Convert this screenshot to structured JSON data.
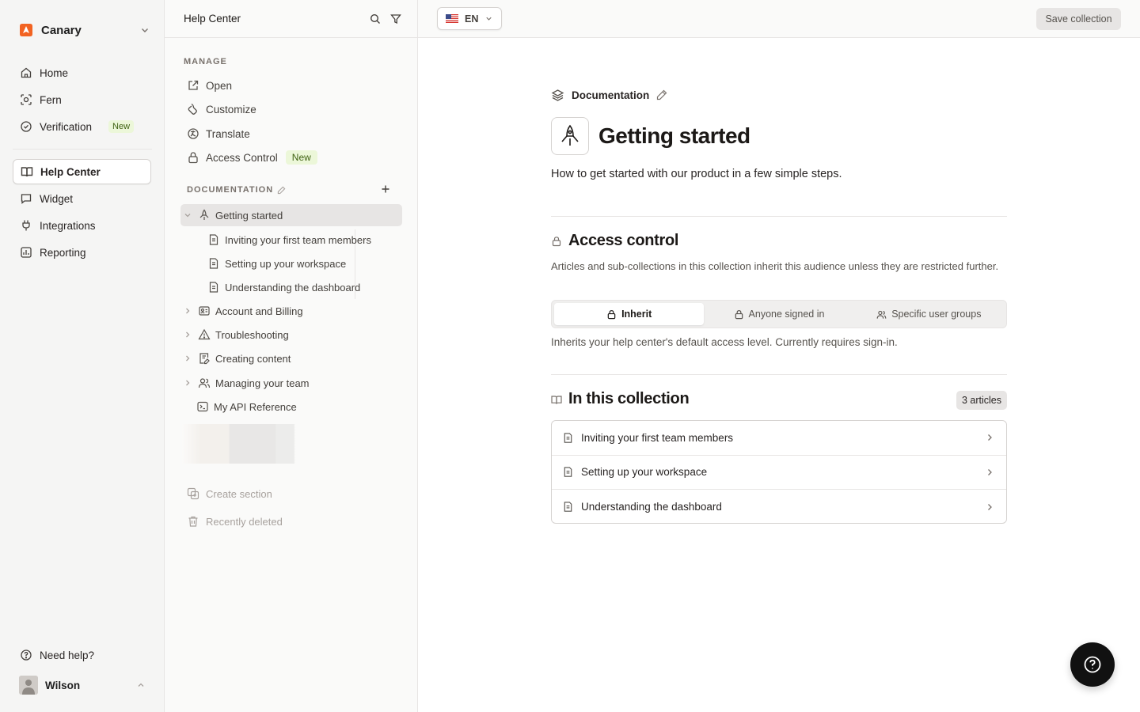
{
  "workspace": {
    "name": "Canary",
    "accent": "#f26322"
  },
  "nav": {
    "items": [
      {
        "label": "Home",
        "icon": "home-icon"
      },
      {
        "label": "Fern",
        "icon": "scan-icon"
      },
      {
        "label": "Verification",
        "icon": "check-circle-icon",
        "badge": "New"
      },
      {
        "label": "Help Center",
        "icon": "book-open-icon",
        "active": true
      },
      {
        "label": "Widget",
        "icon": "message-square-icon"
      },
      {
        "label": "Integrations",
        "icon": "plug-icon"
      },
      {
        "label": "Reporting",
        "icon": "chart-icon"
      }
    ],
    "help": "Need help?",
    "user": "Wilson"
  },
  "panel": {
    "title": "Help Center",
    "manage_label": "MANAGE",
    "manage_items": [
      {
        "label": "Open",
        "icon": "external-link-icon"
      },
      {
        "label": "Customize",
        "icon": "paint-icon"
      },
      {
        "label": "Translate",
        "icon": "translate-icon"
      },
      {
        "label": "Access Control",
        "icon": "lock-icon",
        "badge": "New"
      }
    ],
    "docs_label": "DOCUMENTATION",
    "tree": {
      "selected": "Getting started",
      "children": [
        "Inviting your first team members",
        "Setting up your workspace",
        "Understanding the dashboard"
      ],
      "collections": [
        "Account and Billing",
        "Troubleshooting",
        "Creating content",
        "Managing your team"
      ],
      "api": "My API Reference"
    },
    "create_section": "Create section",
    "recently_deleted": "Recently deleted"
  },
  "topbar": {
    "language": "EN",
    "save": "Save collection"
  },
  "main": {
    "crumb": "Documentation",
    "title": "Getting started",
    "description": "How to get started with our product in a few simple steps.",
    "access": {
      "heading": "Access control",
      "description": "Articles and sub-collections in this collection inherit this audience unless they are restricted further.",
      "options": [
        "Inherit",
        "Anyone signed in",
        "Specific user groups"
      ],
      "selected": "Inherit",
      "note": "Inherits your help center's default access level. Currently requires sign-in."
    },
    "collection": {
      "heading": "In this collection",
      "count": "3 articles",
      "articles": [
        "Inviting your first team members",
        "Setting up your workspace",
        "Understanding the dashboard"
      ]
    }
  }
}
